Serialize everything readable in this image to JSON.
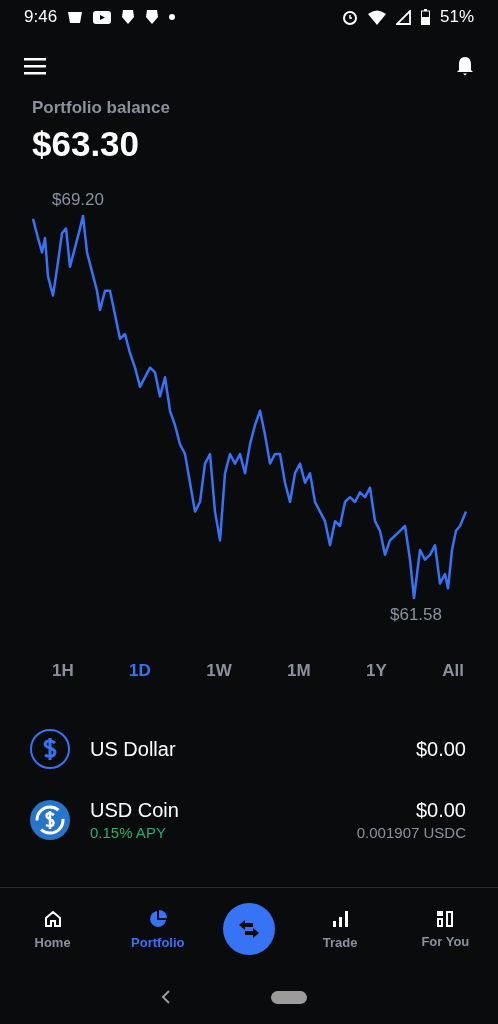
{
  "status_bar": {
    "time": "9:46",
    "battery": "51%"
  },
  "header": {
    "label": "Portfolio balance",
    "balance": "$63.30"
  },
  "chart": {
    "high_label": "$69.20",
    "low_label": "$61.58"
  },
  "ranges": [
    {
      "label": "1H",
      "selected": false
    },
    {
      "label": "1D",
      "selected": true
    },
    {
      "label": "1W",
      "selected": false
    },
    {
      "label": "1M",
      "selected": false
    },
    {
      "label": "1Y",
      "selected": false
    },
    {
      "label": "All",
      "selected": false
    }
  ],
  "assets": [
    {
      "kind": "fiat",
      "name": "US Dollar",
      "value": "$0.00"
    },
    {
      "kind": "coin",
      "name": "USD Coin",
      "subtitle": "0.15% APY",
      "value": "$0.00",
      "amount": "0.001907 USDC"
    }
  ],
  "nav": [
    {
      "kind": "home",
      "label": "Home",
      "selected": false
    },
    {
      "kind": "portfolio",
      "label": "Portfolio",
      "selected": true
    },
    {
      "kind": "swap"
    },
    {
      "kind": "trade",
      "label": "Trade",
      "selected": false
    },
    {
      "kind": "foryou",
      "label": "For You",
      "selected": false
    }
  ]
}
